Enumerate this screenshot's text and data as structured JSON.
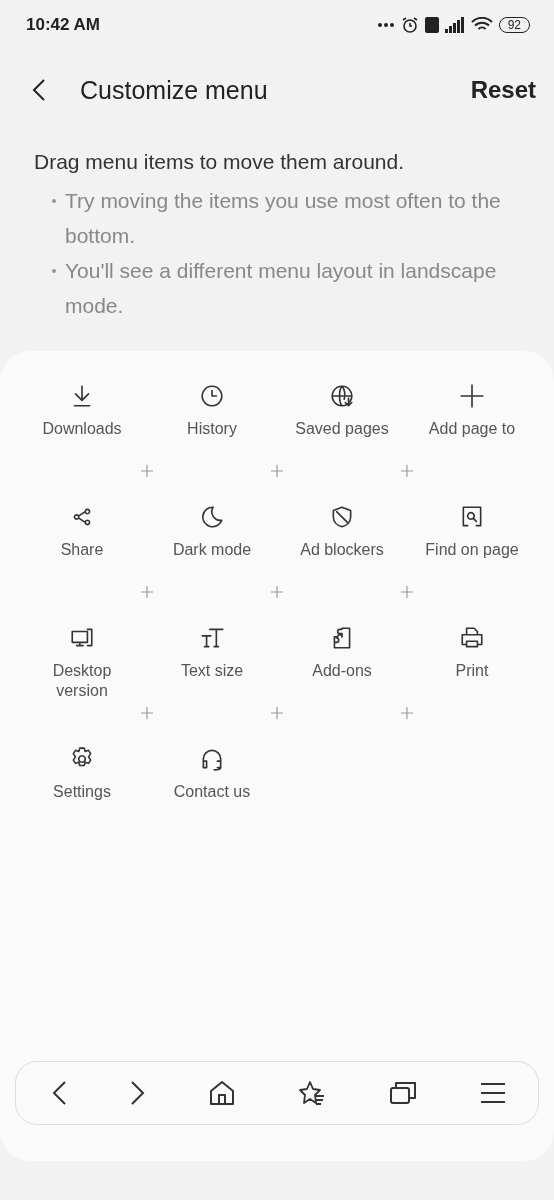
{
  "status_bar": {
    "time": "10:42 AM",
    "battery": "92"
  },
  "header": {
    "title": "Customize menu",
    "action": "Reset"
  },
  "intro": {
    "text": "Drag menu items to move them around.",
    "bullets": [
      "Try moving the items you use most often to the bottom.",
      "You'll see a different menu layout in landscape mode."
    ]
  },
  "menu_items": [
    {
      "label": "Downloads"
    },
    {
      "label": "History"
    },
    {
      "label": "Saved pages"
    },
    {
      "label": "Add page to"
    },
    {
      "label": "Share"
    },
    {
      "label": "Dark mode"
    },
    {
      "label": "Ad blockers"
    },
    {
      "label": "Find on page"
    },
    {
      "label": "Desktop version"
    },
    {
      "label": "Text size"
    },
    {
      "label": "Add-ons"
    },
    {
      "label": "Print"
    },
    {
      "label": "Settings"
    },
    {
      "label": "Contact us"
    }
  ]
}
